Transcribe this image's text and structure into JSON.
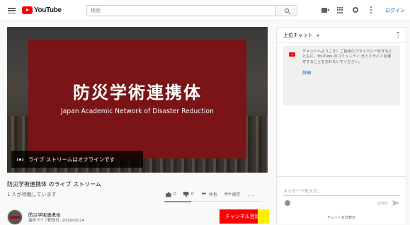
{
  "header": {
    "logo_text": "YouTube",
    "search_placeholder": "検索",
    "login_label": "ログイン"
  },
  "video": {
    "banner_title_jp": "防災学術連携体",
    "banner_title_en": "Japan Academic Network of Disaster Reduction",
    "offline_message": "ライブ ストリームはオフラインです",
    "title": "防災学術連携体 のライブ ストリーム",
    "waiting": "1 人が待機しています",
    "likes": "0",
    "dislikes": "0",
    "share_label": "共有",
    "save_label": "保存",
    "more_label": "..."
  },
  "channel": {
    "name": "防災学術連携体",
    "date": "最終ライブ配信日: 2019/02/14",
    "subscribe_label": "チャンネル登録"
  },
  "chat": {
    "title": "上位チャット",
    "welcome": "チャットへようこそ！ご自身のプライバシーを守るとともに、YouTube のコミュニティ ガイドラインを遵守することを忘れないでください。",
    "details_label": "詳細",
    "input_placeholder": "メッセージを入力...",
    "char_count": "0/200",
    "hide_label": "チャットを非表示"
  },
  "colors": {
    "accent": "#ff0000",
    "banner": "#7a1417",
    "link": "#065fd4"
  }
}
